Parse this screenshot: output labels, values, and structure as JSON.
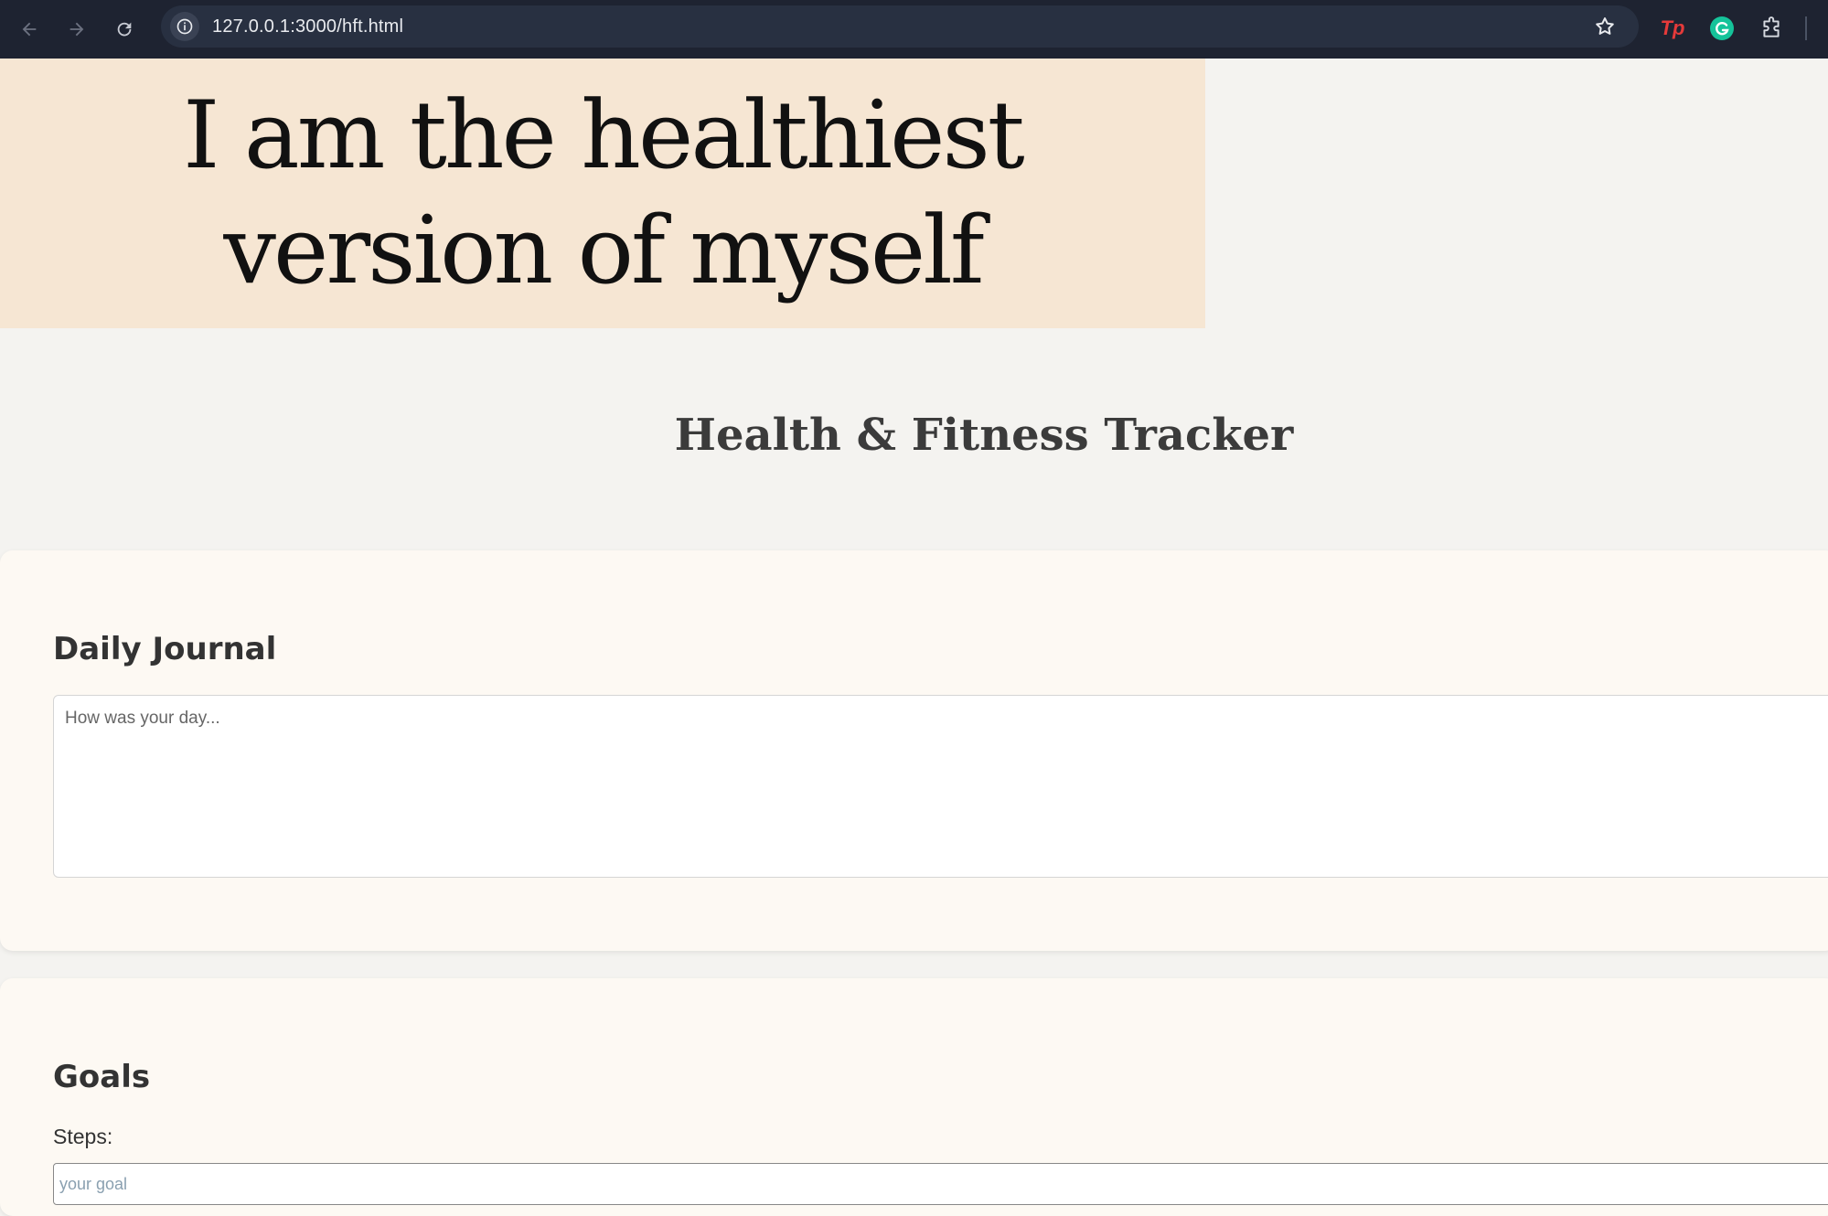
{
  "browser": {
    "url": "127.0.0.1:3000/hft.html",
    "extensions": [
      "tp-icon",
      "grammarly-icon",
      "puzzle-extensions-icon"
    ],
    "ext_tp_label": "Tp"
  },
  "banner": {
    "line1": "I am the healthiest",
    "line2": "version of myself"
  },
  "page": {
    "title": "Health & Fitness Tracker"
  },
  "journal": {
    "heading": "Daily Journal",
    "placeholder": "How was your day...",
    "value": ""
  },
  "goals": {
    "heading": "Goals",
    "steps_label": "Steps:",
    "steps_placeholder": "your goal",
    "steps_value": ""
  },
  "colors": {
    "toolbar_bg": "#1e2331",
    "banner_bg": "#f6e6d3",
    "page_bg": "#f4f3f0",
    "card_bg": "#fdf9f3",
    "title_color": "#3b3b3b"
  }
}
